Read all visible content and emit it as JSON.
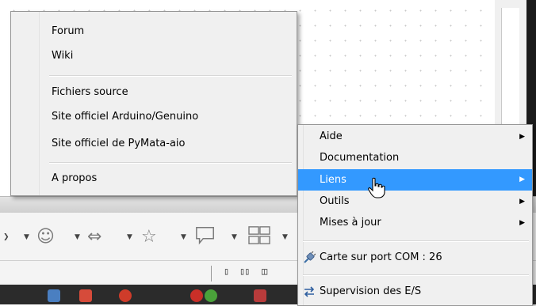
{
  "links_menu": {
    "items": [
      "Forum",
      "Wiki",
      "Fichiers source",
      "Site officiel Arduino/Genuino",
      "Site officiel de PyMata-aio",
      "A propos"
    ]
  },
  "main_menu": {
    "items": {
      "aide": "Aide",
      "documentation": "Documentation",
      "liens": "Liens",
      "outils": "Outils",
      "mises_a_jour": "Mises à jour",
      "carte_com": "Carte sur port COM : 26",
      "supervision": "Supervision des E/S"
    }
  },
  "icons": {
    "smiley": "smiley-icon",
    "arrows": "left-right-arrow-icon",
    "star": "star-icon",
    "callout": "speech-bubble-icon",
    "flowchart": "flowchart-icon",
    "board": "plug-icon",
    "supervision": "io-arrows-icon"
  },
  "colors": {
    "highlight": "#3399ff",
    "menu_bg": "#f0f0f0"
  }
}
